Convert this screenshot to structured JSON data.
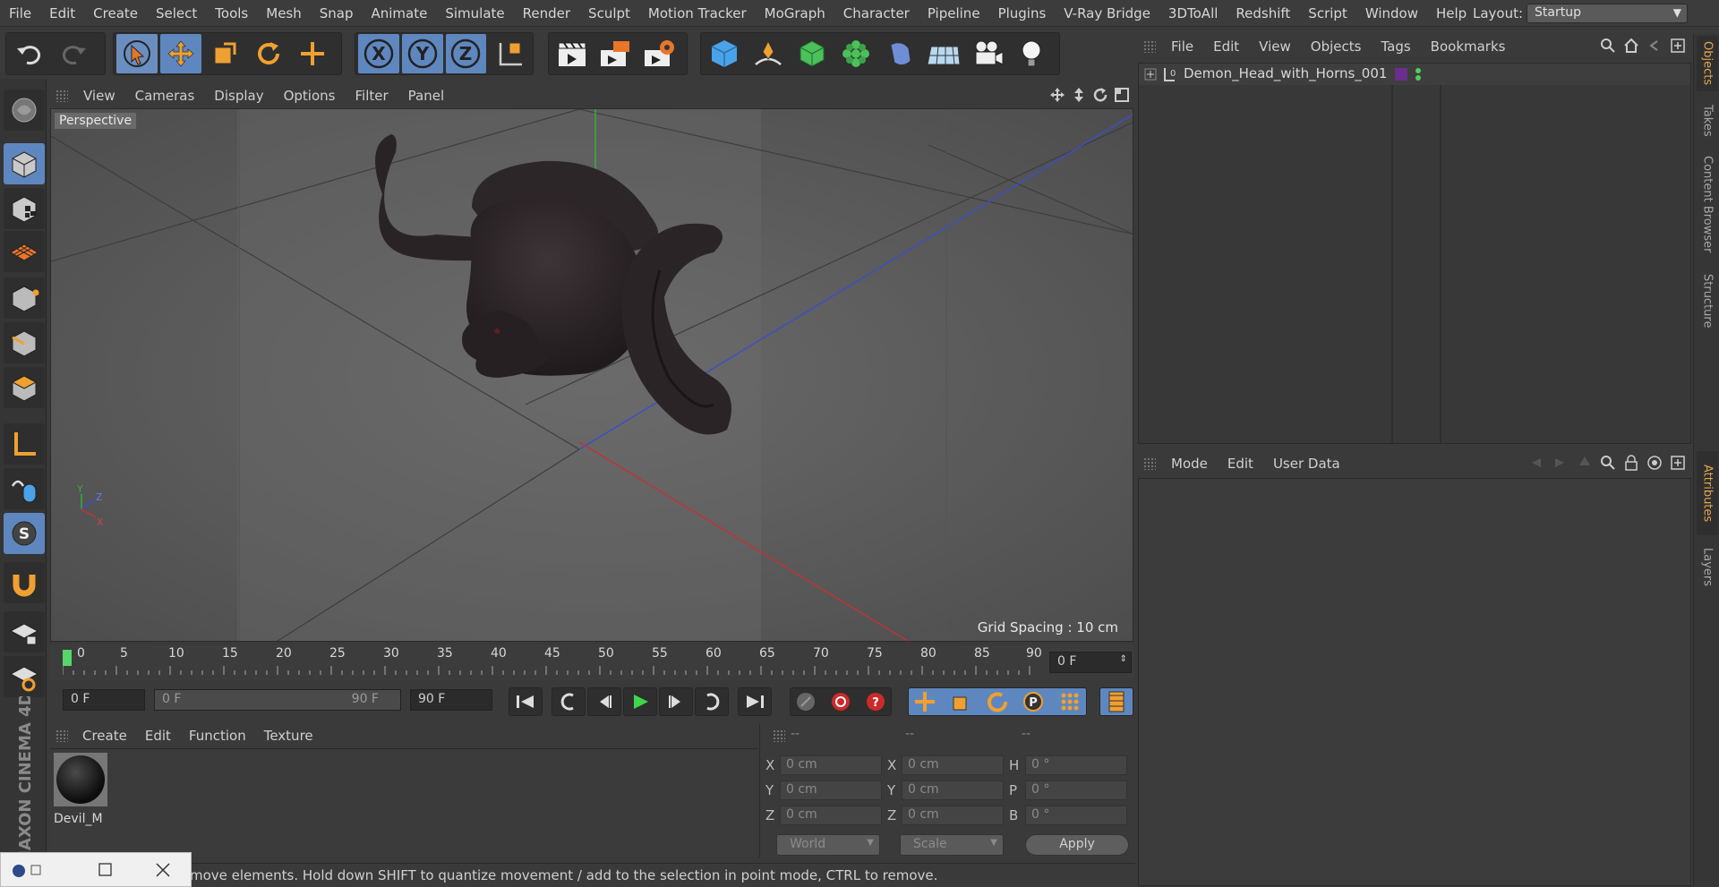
{
  "menu": [
    "File",
    "Edit",
    "Create",
    "Select",
    "Tools",
    "Mesh",
    "Snap",
    "Animate",
    "Simulate",
    "Render",
    "Sculpt",
    "Motion Tracker",
    "MoGraph",
    "Character",
    "Pipeline",
    "Plugins",
    "V-Ray Bridge",
    "3DToAll",
    "Redshift",
    "Script",
    "Window",
    "Help"
  ],
  "layout": {
    "label": "Layout:",
    "value": "Startup"
  },
  "toolbar": {
    "x": "X",
    "y": "Y",
    "z": "Z"
  },
  "viewport": {
    "menu": [
      "View",
      "Cameras",
      "Display",
      "Options",
      "Filter",
      "Panel"
    ],
    "label": "Perspective",
    "grid_spacing": "Grid Spacing : 10 cm",
    "axis_y": "Y",
    "axis_z": "Z",
    "axis_x": "X"
  },
  "timeline": {
    "ticks": [
      "0",
      "5",
      "10",
      "15",
      "20",
      "25",
      "30",
      "35",
      "40",
      "45",
      "50",
      "55",
      "60",
      "65",
      "70",
      "75",
      "80",
      "85",
      "90"
    ],
    "current_frame": "0 F",
    "start_frame": "0 F",
    "range_start": "0 F",
    "range_end": "90 F",
    "end_frame": "90 F"
  },
  "materials": {
    "menu": [
      "Create",
      "Edit",
      "Function",
      "Texture"
    ],
    "items": [
      {
        "name": "Devil_M"
      }
    ]
  },
  "coords": {
    "headers": [
      "--",
      "--",
      "--"
    ],
    "pos": [
      {
        "label": "X",
        "value": "0 cm"
      },
      {
        "label": "Y",
        "value": "0 cm"
      },
      {
        "label": "Z",
        "value": "0 cm"
      }
    ],
    "size": [
      {
        "label": "X",
        "value": "0 cm"
      },
      {
        "label": "Y",
        "value": "0 cm"
      },
      {
        "label": "Z",
        "value": "0 cm"
      }
    ],
    "rot": [
      {
        "label": "H",
        "value": "0 °"
      },
      {
        "label": "P",
        "value": "0 °"
      },
      {
        "label": "B",
        "value": "0 °"
      }
    ],
    "mode1": "World",
    "mode2": "Scale",
    "apply": "Apply"
  },
  "objects": {
    "menu": [
      "File",
      "Edit",
      "View",
      "Objects",
      "Tags",
      "Bookmarks"
    ],
    "items": [
      {
        "name": "Demon_Head_with_Horns_001"
      }
    ]
  },
  "attributes": {
    "menu": [
      "Mode",
      "Edit",
      "User Data"
    ]
  },
  "right_tabs": [
    "Objects",
    "Takes",
    "Content Browser",
    "Structure",
    "Attributes",
    "Layers"
  ],
  "branding": "MAXON CINEMA 4D",
  "status": "move elements. Hold down SHIFT to quantize movement / add to the selection in point mode, CTRL to remove.",
  "colors": {
    "accent_blue": "#5f87bf",
    "accent_orange": "#e3a650",
    "timeline_marker": "#56d66a"
  }
}
